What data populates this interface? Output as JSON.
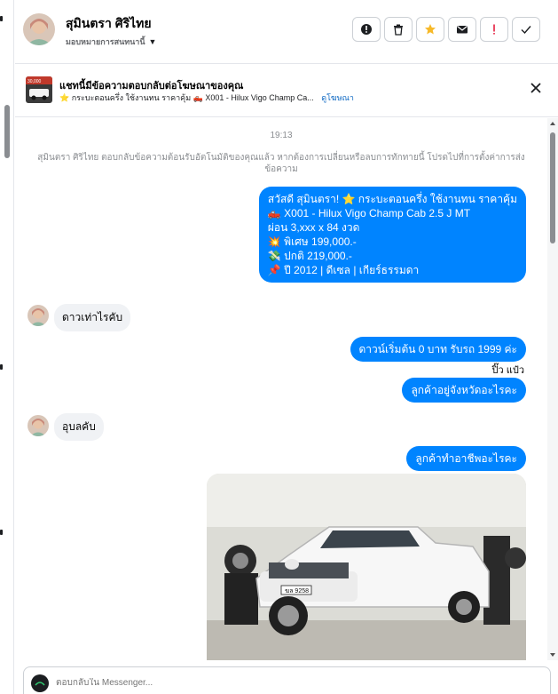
{
  "header": {
    "contact_name": "สุมินตรา ศิริไทย",
    "assign_label": "มอบหมายการสนทนานี้",
    "actions": [
      {
        "icon": "exclamation-circle-icon",
        "color": "#1c1e21"
      },
      {
        "icon": "trash-icon",
        "color": "#1c1e21"
      },
      {
        "icon": "star-icon",
        "color": "#f7b928"
      },
      {
        "icon": "envelope-icon",
        "color": "#1c1e21"
      },
      {
        "icon": "exclamation-mark-icon",
        "color": "#e41e3f"
      },
      {
        "icon": "check-icon",
        "color": "#1c1e21"
      }
    ]
  },
  "banner": {
    "title": "แชทนี้มีข้อความตอบกลับต่อโฆษณาของคุณ",
    "subtitle": "⭐ กระบะตอนครึ่ง ใช้งานทน ราคาคุ้ม 🛻 X001 - Hilux Vigo Champ Ca...",
    "link_label": "ดูโฆษณา",
    "thumb_badge": "30,000"
  },
  "chat": {
    "time_separator": "19:13",
    "system_note": "สุมินตรา ศิริไทย ตอบกลับข้อความต้อนรับอัตโนมัติของคุณแล้ว หากต้องการเปลี่ยนหรือลบการทักทายนี้ โปรดไปที่การตั้งค่าการส่งข้อความ",
    "outgoing_1_lines": [
      "สวัสดี สุมินตรา! ⭐ กระบะตอนครึ่ง ใช้งานทน ราคาคุ้ม",
      "🛻 X001 - Hilux Vigo Champ Cab 2.5 J MT",
      "ผ่อน 3,xxx x 84 งวด",
      "💥 พิเศษ 199,000.-",
      "💸 ปกติ 219,000.-",
      "📌 ปี 2012 | ดีเซล | เกียร์ธรรมดา"
    ],
    "incoming_1": "ดาวเท่าไรคับ",
    "outgoing_2": "ดาวน์เริ่มต้น 0 บาท รับรถ 1999 ค่ะ",
    "reaction_label": "ปิ๊ว แป๋ว",
    "outgoing_3": "ลูกค้าอยู่จังหวัดอะไรคะ",
    "incoming_2": "อุบลคับ",
    "outgoing_4": "ลูกค้าทำอาชีพอะไรคะ",
    "photo_plate": "ฆล 9258"
  },
  "composer": {
    "placeholder": "ตอบกลับใน Messenger..."
  },
  "colors": {
    "accent": "#0084ff",
    "incoming_bubble": "#f0f2f5"
  }
}
